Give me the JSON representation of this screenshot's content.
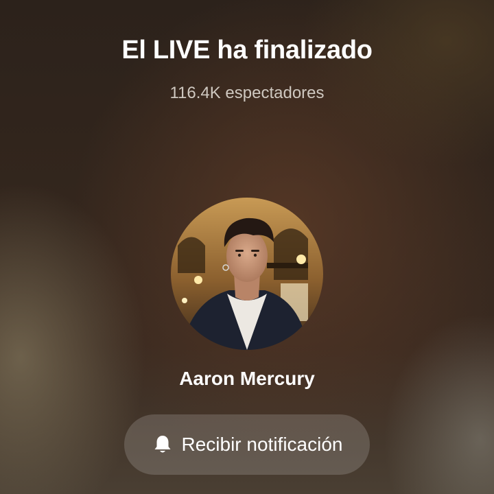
{
  "live_end": {
    "title": "El LIVE ha finalizado",
    "viewers": "116.4K espectadores"
  },
  "host": {
    "name": "Aaron Mercury",
    "avatar": "profile-photo"
  },
  "notify_button": {
    "label": "Recibir notificación",
    "icon": "bell-icon"
  }
}
